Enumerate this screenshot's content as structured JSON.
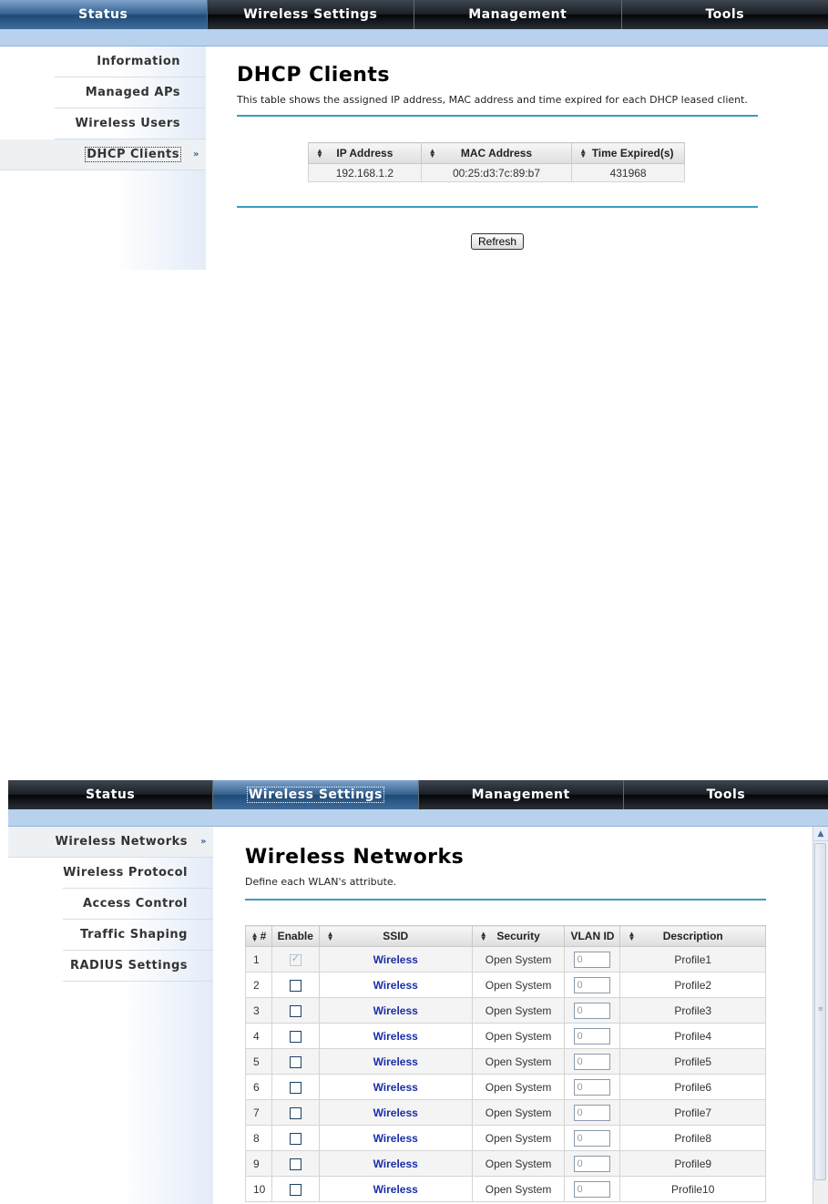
{
  "shot1": {
    "nav": [
      "Status",
      "Wireless Settings",
      "Management",
      "Tools"
    ],
    "sidebar": [
      "Information",
      "Managed APs",
      "Wireless Users",
      "DHCP Clients"
    ],
    "title": "DHCP Clients",
    "description": "This table shows the assigned IP address, MAC address and time expired for each DHCP leased client.",
    "table": {
      "headers": [
        "IP Address",
        "MAC Address",
        "Time Expired(s)"
      ],
      "rows": [
        [
          "192.168.1.2",
          "00:25:d3:7c:89:b7",
          "431968"
        ]
      ]
    },
    "refresh_label": "Refresh"
  },
  "shot2": {
    "nav": [
      "Status",
      "Wireless Settings",
      "Management",
      "Tools"
    ],
    "sidebar": [
      "Wireless Networks",
      "Wireless Protocol",
      "Access Control",
      "Traffic Shaping",
      "RADIUS Settings"
    ],
    "title": "Wireless Networks",
    "description": "Define each WLAN's attribute.",
    "table": {
      "headers": [
        "#",
        "Enable",
        "SSID",
        "Security",
        "VLAN ID",
        "Description"
      ],
      "rows": [
        {
          "num": "1",
          "ssid": "Wireless",
          "security": "Open System",
          "vlan": "0",
          "desc": "Profile1"
        },
        {
          "num": "2",
          "ssid": "Wireless",
          "security": "Open System",
          "vlan": "0",
          "desc": "Profile2"
        },
        {
          "num": "3",
          "ssid": "Wireless",
          "security": "Open System",
          "vlan": "0",
          "desc": "Profile3"
        },
        {
          "num": "4",
          "ssid": "Wireless",
          "security": "Open System",
          "vlan": "0",
          "desc": "Profile4"
        },
        {
          "num": "5",
          "ssid": "Wireless",
          "security": "Open System",
          "vlan": "0",
          "desc": "Profile5"
        },
        {
          "num": "6",
          "ssid": "Wireless",
          "security": "Open System",
          "vlan": "0",
          "desc": "Profile6"
        },
        {
          "num": "7",
          "ssid": "Wireless",
          "security": "Open System",
          "vlan": "0",
          "desc": "Profile7"
        },
        {
          "num": "8",
          "ssid": "Wireless",
          "security": "Open System",
          "vlan": "0",
          "desc": "Profile8"
        },
        {
          "num": "9",
          "ssid": "Wireless",
          "security": "Open System",
          "vlan": "0",
          "desc": "Profile9"
        },
        {
          "num": "10",
          "ssid": "Wireless",
          "security": "Open System",
          "vlan": "0",
          "desc": "Profile10"
        }
      ]
    }
  },
  "colors": {
    "accent_line": "#3a9bc4",
    "nav_dark": "#1b2026",
    "nav_active": "#35628f",
    "band": "#b8d2ee",
    "link": "#1a2ea8"
  },
  "icons": {
    "sort": "sort-updown-icon",
    "nav_arrow": "double-chevron-right-icon",
    "scroll_up": "scroll-up-icon"
  }
}
